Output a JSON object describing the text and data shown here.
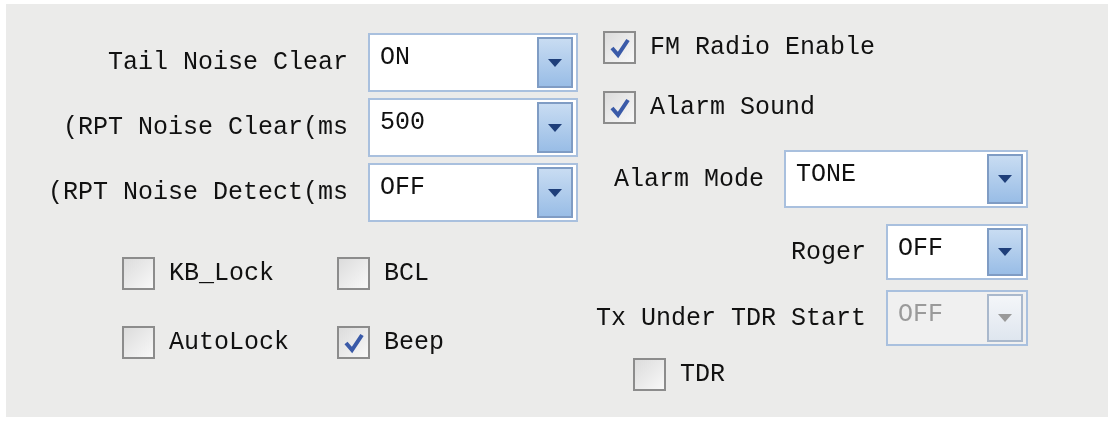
{
  "left": {
    "fields": [
      {
        "label": "Tail Noise Clear",
        "value": "ON",
        "disabled": false
      },
      {
        "label": "(RPT Noise Clear(ms",
        "value": "500",
        "disabled": false
      },
      {
        "label": "(RPT Noise Detect(ms",
        "value": "OFF",
        "disabled": false
      }
    ],
    "checkboxes": [
      {
        "label": "KB_Lock",
        "checked": false
      },
      {
        "label": "BCL",
        "checked": false
      },
      {
        "label": "AutoLock",
        "checked": false
      },
      {
        "label": "Beep",
        "checked": true
      }
    ]
  },
  "right": {
    "checkboxes": [
      {
        "label": "FM Radio Enable",
        "checked": true
      },
      {
        "label": "Alarm Sound",
        "checked": true
      }
    ],
    "fields": [
      {
        "label": "Alarm Mode",
        "value": "TONE",
        "disabled": false
      },
      {
        "label": "Roger",
        "value": "OFF",
        "disabled": false
      },
      {
        "label": "Tx Under TDR Start",
        "value": "OFF",
        "disabled": true
      }
    ],
    "bottom_checkboxes": [
      {
        "label": "TDR",
        "checked": false
      }
    ]
  }
}
